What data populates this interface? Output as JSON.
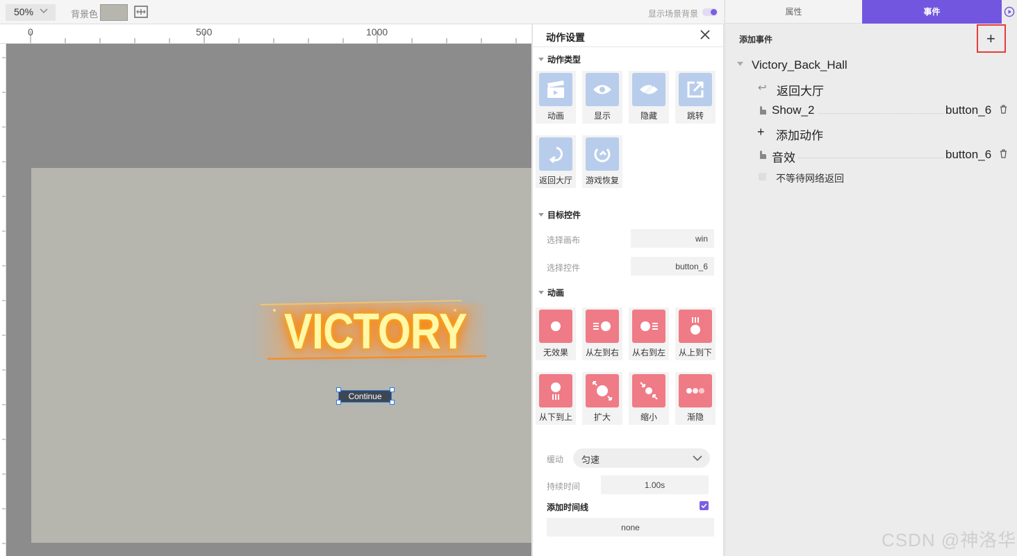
{
  "toolbar": {
    "zoom": "50%",
    "bg_label": "背景色",
    "bg_color": "#b6b5ae",
    "scene_bg_label": "显示场景背景"
  },
  "ruler": {
    "labels": [
      "0",
      "500",
      "1000"
    ]
  },
  "canvas": {
    "victory_text": "VICTORY",
    "continue_label": "Continue"
  },
  "action_panel": {
    "title": "动作设置",
    "action_type_title": "动作类型",
    "action_types": [
      {
        "label": "动画",
        "icon": "clapperboard-icon"
      },
      {
        "label": "显示",
        "icon": "eye-icon"
      },
      {
        "label": "隐藏",
        "icon": "eye-off-icon"
      },
      {
        "label": "跳转",
        "icon": "external-link-icon"
      },
      {
        "label": "返回大厅",
        "icon": "return-icon"
      },
      {
        "label": "游戏恢复",
        "icon": "restore-icon"
      }
    ],
    "target_title": "目标控件",
    "canvas_label": "选择画布",
    "canvas_value": "win",
    "control_label": "选择控件",
    "control_value": "button_6",
    "anim_title": "动画",
    "animations": [
      {
        "label": "无效果"
      },
      {
        "label": "从左到右"
      },
      {
        "label": "从右到左"
      },
      {
        "label": "从上到下"
      },
      {
        "label": "从下到上"
      },
      {
        "label": "扩大"
      },
      {
        "label": "缩小"
      },
      {
        "label": "渐隐"
      }
    ],
    "easing_label": "缓动",
    "easing_value": "匀速",
    "duration_label": "持续时间",
    "duration_value": "1.00s",
    "timeline_label": "添加时间线",
    "timeline_value": "none"
  },
  "right_panel": {
    "tab_props": "属性",
    "tab_events": "事件",
    "add_event_label": "添加事件",
    "add_event_button": "+",
    "event_name": "Victory_Back_Hall",
    "actions": [
      {
        "label": "返回大厅",
        "target": ""
      },
      {
        "label": "Show_2",
        "target": "button_6"
      },
      {
        "label": "添加动作",
        "target": ""
      },
      {
        "label": "音效",
        "target": "button_6"
      }
    ],
    "no_wait_label": "不等待网络返回"
  },
  "watermark": "CSDN @神洛华",
  "colors": {
    "accent": "#7356e0",
    "highlight_border": "#e53b3b",
    "anim_tile": "#ef7b86",
    "type_tile": "#b8cdec"
  }
}
